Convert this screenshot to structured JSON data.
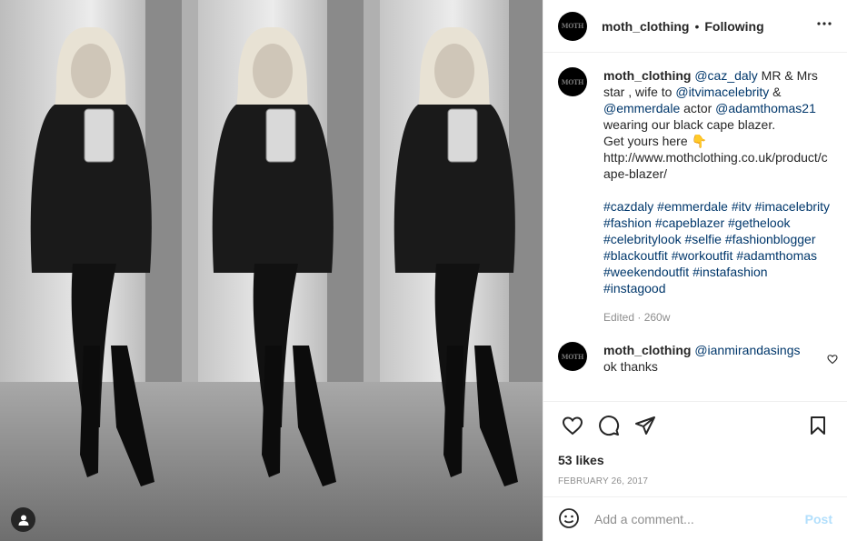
{
  "photo": {
    "alt_icon": "user-tag-icon"
  },
  "header": {
    "username": "moth_clothing",
    "separator": "•",
    "follow_state": "Following",
    "avatar_text": "MOTH",
    "more_icon": "ellipsis-icon"
  },
  "caption": {
    "username": "moth_clothing",
    "parts": [
      {
        "t": "mention",
        "v": "@caz_daly"
      },
      {
        "t": "text",
        "v": " MR & Mrs star , wife to "
      },
      {
        "t": "mention",
        "v": "@itvimacelebrity"
      },
      {
        "t": "text",
        "v": " & "
      },
      {
        "t": "mention",
        "v": "@emmerdale"
      },
      {
        "t": "text",
        "v": " actor "
      },
      {
        "t": "mention",
        "v": "@adamthomas21"
      },
      {
        "t": "text",
        "v": " wearing our black cape blazer."
      }
    ],
    "line2": "Get yours here 👇",
    "url": "http://www.mothclothing.co.uk/product/cape-blazer/",
    "hashtags": [
      "#cazdaly",
      "#emmerdale",
      "#itv",
      "#imacelebrity",
      "#fashion",
      "#capeblazer",
      "#gethelook",
      "#celebritylook",
      "#selfie",
      "#fashionblogger",
      "#blackoutfit",
      "#workoutfit",
      "#adamthomas",
      "#weekendoutfit",
      "#instafashion",
      "#instagood"
    ],
    "meta": "Edited · 260w"
  },
  "reply": {
    "username": "moth_clothing",
    "mention": "@ianmirandasings",
    "text": "ok thanks"
  },
  "actions": {
    "like_icon": "heart-icon",
    "comment_icon": "comment-icon",
    "share_icon": "share-icon",
    "save_icon": "bookmark-icon"
  },
  "likes": "53 likes",
  "date": "FEBRUARY 26, 2017",
  "add_comment": {
    "placeholder": "Add a comment...",
    "emoji_icon": "smiley-icon",
    "post_label": "Post"
  }
}
